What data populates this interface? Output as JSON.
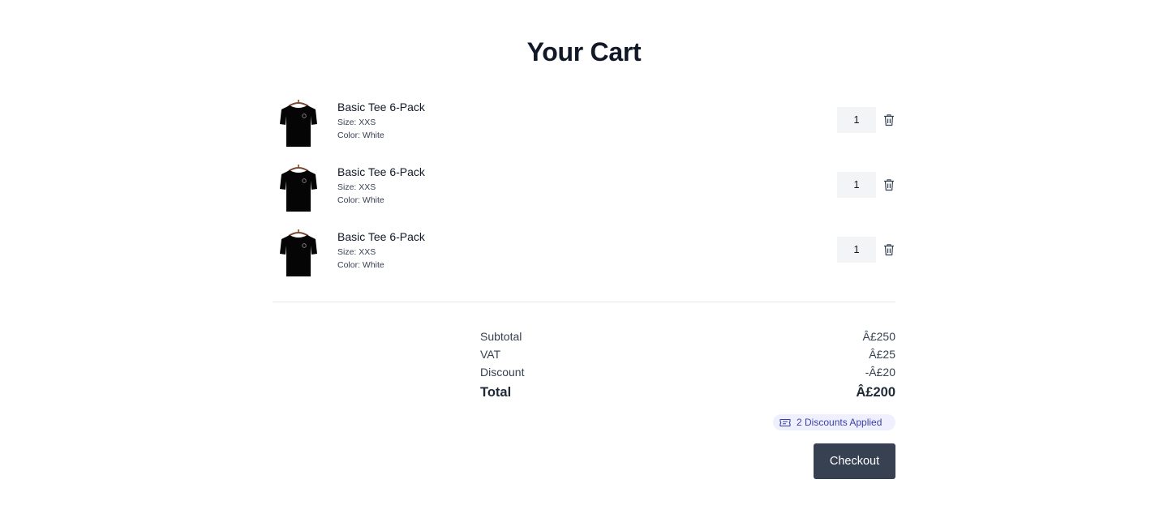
{
  "page": {
    "title": "Your Cart"
  },
  "cart": {
    "items": [
      {
        "name": "Basic Tee 6-Pack",
        "size": "Size: XXS",
        "color": "Color: White",
        "quantity": "1",
        "image_icon": "black-tshirt-image",
        "delete_icon": "trash-icon"
      },
      {
        "name": "Basic Tee 6-Pack",
        "size": "Size: XXS",
        "color": "Color: White",
        "quantity": "1",
        "image_icon": "black-tshirt-image",
        "delete_icon": "trash-icon"
      },
      {
        "name": "Basic Tee 6-Pack",
        "size": "Size: XXS",
        "color": "Color: White",
        "quantity": "1",
        "image_icon": "black-tshirt-image",
        "delete_icon": "trash-icon"
      }
    ]
  },
  "summary": {
    "subtotal_label": "Subtotal",
    "subtotal_value": "Â£250",
    "vat_label": "VAT",
    "vat_value": "Â£25",
    "discount_label": "Discount",
    "discount_value": "-Â£20",
    "total_label": "Total",
    "total_value": "Â£200"
  },
  "discount_badge": {
    "label": "2 Discounts Applied",
    "icon": "ticket-icon"
  },
  "checkout": {
    "label": "Checkout"
  },
  "colors": {
    "primary_button": "#374151",
    "badge_bg": "#eef0fd",
    "badge_text": "#3f3fa8",
    "qty_bg": "#f3f4f6"
  }
}
